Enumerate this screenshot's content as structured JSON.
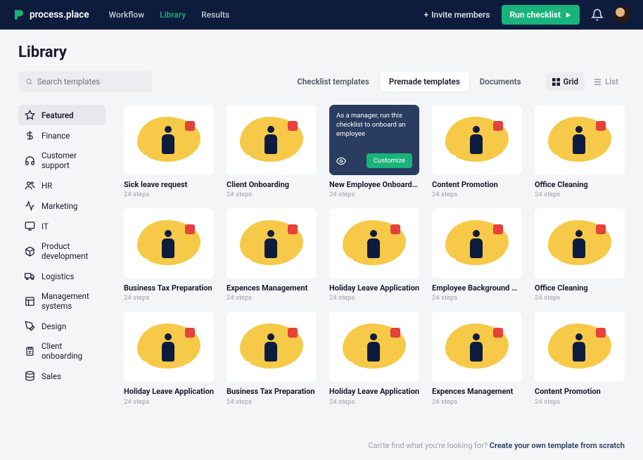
{
  "brand": "process.place",
  "nav": {
    "workflow": "Workflow",
    "library": "Library",
    "results": "Results"
  },
  "invite_label": "Invite members",
  "run_label": "Run checklist",
  "page_title": "Library",
  "search_placeholder": "Search templates",
  "segments": {
    "checklist": "Checklist templates",
    "premade": "Premade templates",
    "documents": "Documents"
  },
  "views": {
    "grid": "Grid",
    "list": "List"
  },
  "sidebar": {
    "items": [
      {
        "label": "Featured"
      },
      {
        "label": "Finance"
      },
      {
        "label": "Customer support"
      },
      {
        "label": "HR"
      },
      {
        "label": "Marketing"
      },
      {
        "label": "IT"
      },
      {
        "label": "Product development"
      },
      {
        "label": "Logistics"
      },
      {
        "label": "Management systems"
      },
      {
        "label": "Design"
      },
      {
        "label": "Client onboarding"
      },
      {
        "label": "Sales"
      }
    ]
  },
  "hover_card": {
    "description": "As a manager, run this checklist to onboard an employee",
    "customize": "Customize"
  },
  "cards": [
    {
      "title": "Sick leave request",
      "steps": "24 steps"
    },
    {
      "title": "Client Onboarding",
      "steps": "24 steps"
    },
    {
      "title": "New Employee Onboarding",
      "steps": "24 steps"
    },
    {
      "title": "Content Promotion",
      "steps": "24 steps"
    },
    {
      "title": "Office Cleaning",
      "steps": "24 steps"
    },
    {
      "title": "Business Tax Preparation",
      "steps": "24 steps"
    },
    {
      "title": "Expences Management",
      "steps": "24 steps"
    },
    {
      "title": "Holiday Leave Application",
      "steps": "24 steps"
    },
    {
      "title": "Employee Background Ch...",
      "steps": "24 steps"
    },
    {
      "title": "Office Cleaning",
      "steps": "24 steps"
    },
    {
      "title": "Holiday Leave Application",
      "steps": "24 steps"
    },
    {
      "title": "Business Tax Preparation",
      "steps": "24 steps"
    },
    {
      "title": "Holiday Leave Application",
      "steps": "24 steps"
    },
    {
      "title": "Expences Management",
      "steps": "24 steps"
    },
    {
      "title": "Content Promotion",
      "steps": "24 steps"
    }
  ],
  "footer": {
    "question": "Can'te find what you're looking for? ",
    "link": "Create your own template from scratch"
  }
}
